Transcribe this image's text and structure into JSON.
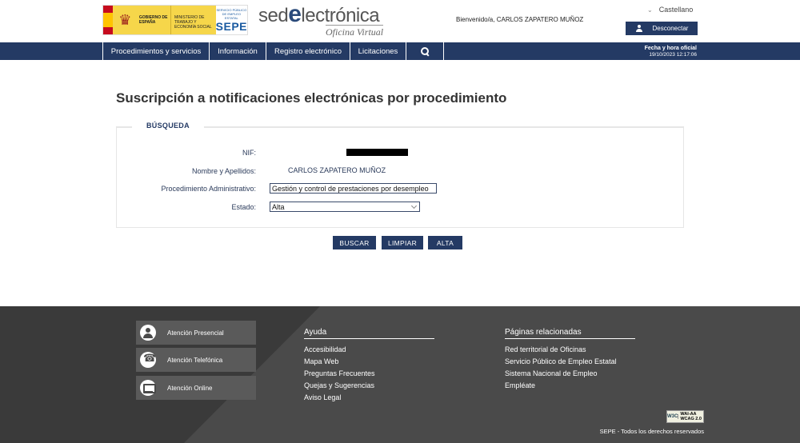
{
  "header": {
    "gov_logo": {
      "line1": "GOBIERNO DE ESPAÑA",
      "line2": "MINISTERIO DE TRABAJO Y ECONOMÍA SOCIAL",
      "sepe_small": "SERVICIO PÚBLICO DE EMPLEO ESTATAL",
      "sepe_big": "SEPE"
    },
    "sede": {
      "prefix": "sed",
      "e": "e",
      "suffix": "lectrónica",
      "sub": "Oficina Virtual"
    },
    "welcome": "Bienvenido/a, CARLOS ZAPATERO MUÑOZ",
    "language": "Castellano",
    "disconnect_label": "Desconectar"
  },
  "nav": {
    "items": [
      {
        "label": "Procedimientos y servicios"
      },
      {
        "label": "Información"
      },
      {
        "label": "Registro electrónico"
      },
      {
        "label": "Licitaciones"
      }
    ],
    "datetime_label": "Fecha y hora oficial",
    "datetime_value": "19/10/2023 12:17:06"
  },
  "main": {
    "title": "Suscripción a notificaciones electrónicas por procedimiento",
    "section_label": "BÚSQUEDA",
    "fields": {
      "nif_label": "NIF:",
      "name_label": "Nombre y Apellidos:",
      "name_value": "CARLOS ZAPATERO MUÑOZ",
      "procedure_label": "Procedimiento Administrativo:",
      "procedure_value": "Gestión y control de prestaciones por desempleo",
      "state_label": "Estado:",
      "state_value": "Alta"
    },
    "buttons": {
      "search": "BUSCAR",
      "clear": "LIMPIAR",
      "add": "ALTA"
    }
  },
  "footer": {
    "contacts": [
      {
        "label": "Atención Presencial"
      },
      {
        "label": "Atención Telefónica"
      },
      {
        "label": "Atención Online"
      }
    ],
    "help": {
      "title": "Ayuda",
      "links": [
        "Accesibilidad",
        "Mapa Web",
        "Preguntas Frecuentes",
        "Quejas y Sugerencias",
        "Aviso Legal"
      ]
    },
    "related": {
      "title": "Páginas relacionadas",
      "links": [
        "Red territorial de Oficinas",
        "Servicio Público de Empleo Estatal",
        "Sistema Nacional de Empleo",
        "Empléate"
      ]
    },
    "wcag_w3c": "W3C",
    "wcag_text": "WAI-AA WCAG 2.0",
    "rights": "SEPE - Todos los derechos reservados"
  },
  "colors": {
    "primary": "#243a64",
    "footer_bg": "#4a4a4a"
  }
}
